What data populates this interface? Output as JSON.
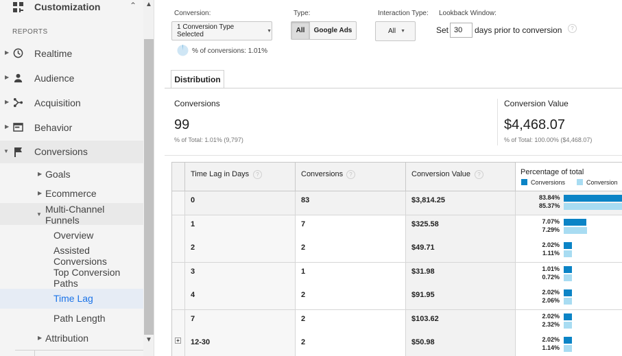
{
  "sidebar": {
    "customization": "Customization",
    "reports_heading": "REPORTS",
    "items": [
      {
        "label": "Realtime"
      },
      {
        "label": "Audience"
      },
      {
        "label": "Acquisition"
      },
      {
        "label": "Behavior"
      },
      {
        "label": "Conversions"
      }
    ],
    "conversions_sub": {
      "goals": "Goals",
      "ecommerce": "Ecommerce",
      "mcf_line1": "Multi-Channel",
      "mcf_line2": "Funnels",
      "overview": "Overview",
      "assisted_line1": "Assisted",
      "assisted_line2": "Conversions",
      "top_line1": "Top Conversion",
      "top_line2": "Paths",
      "time_lag": "Time Lag",
      "path_length": "Path Length",
      "attribution": "Attribution"
    }
  },
  "filters": {
    "conversion_label": "Conversion:",
    "conversion_value": "1 Conversion Type Selected",
    "type_label": "Type:",
    "type_all": "All",
    "type_google_ads": "Google Ads",
    "interaction_label": "Interaction Type:",
    "interaction_value": "All",
    "lookback_label": "Lookback Window:",
    "set_text": "Set",
    "lookback_days": "30",
    "days_text": "days prior to conversion",
    "pct_of_conversions": "% of conversions: 1.01%",
    "pct_of_conversions_value": 1.01
  },
  "tab": {
    "label": "Distribution"
  },
  "summary": {
    "conversions_title": "Conversions",
    "conversions_value": "99",
    "conversions_sub": "% of Total: 1.01% (9,797)",
    "value_title": "Conversion Value",
    "value_value": "$4,468.07",
    "value_sub": "% of Total: 100.00% ($4,468.07)"
  },
  "table": {
    "headers": {
      "lag": "Time Lag in Days",
      "conversions": "Conversions",
      "value": "Conversion Value",
      "pct": "Percentage of total"
    },
    "legend": {
      "conversions": "Conversions",
      "value": "Conversion"
    },
    "rows": [
      {
        "lag": "0",
        "conv": "83",
        "value": "$3,814.25",
        "pct_conv": "83.84%",
        "pct_val": "85.37%",
        "p1": 83.84,
        "p2": 85.37
      },
      {
        "lag": "1",
        "conv": "7",
        "value": "$325.58",
        "pct_conv": "7.07%",
        "pct_val": "7.29%",
        "p1": 7.07,
        "p2": 7.29
      },
      {
        "lag": "2",
        "conv": "2",
        "value": "$49.71",
        "pct_conv": "2.02%",
        "pct_val": "1.11%",
        "p1": 2.02,
        "p2": 1.11
      },
      {
        "lag": "3",
        "conv": "1",
        "value": "$31.98",
        "pct_conv": "1.01%",
        "pct_val": "0.72%",
        "p1": 1.01,
        "p2": 0.72
      },
      {
        "lag": "4",
        "conv": "2",
        "value": "$91.95",
        "pct_conv": "2.02%",
        "pct_val": "2.06%",
        "p1": 2.02,
        "p2": 2.06
      },
      {
        "lag": "7",
        "conv": "2",
        "value": "$103.62",
        "pct_conv": "2.02%",
        "pct_val": "2.32%",
        "p1": 2.02,
        "p2": 2.32
      },
      {
        "lag": "12-30",
        "conv": "2",
        "value": "$50.98",
        "pct_conv": "2.02%",
        "pct_val": "1.14%",
        "p1": 2.02,
        "p2": 1.14
      }
    ]
  },
  "colors": {
    "bar_conversions": "#0b84c6",
    "bar_value": "#a8dcf2",
    "selected_text": "#1a73e8",
    "selected_bg": "#e6ecf5"
  }
}
